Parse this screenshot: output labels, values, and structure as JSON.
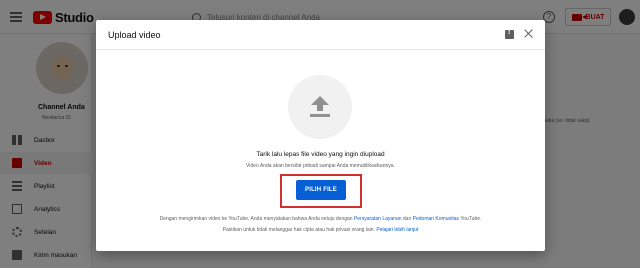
{
  "topbar": {
    "logo_text": "Studio",
    "search_placeholder": "Telusuri konten di channel Anda",
    "help_glyph": "?",
    "create_label": "BUAT"
  },
  "sidebar": {
    "channel_name": "Channel Anda",
    "channel_sub": "Novitarica 01",
    "items": [
      {
        "label": "Dasbor",
        "icon": "dashboard-icon"
      },
      {
        "label": "Video",
        "icon": "video-icon",
        "active": true
      },
      {
        "label": "Playlist",
        "icon": "playlist-icon"
      },
      {
        "label": "Analytics",
        "icon": "analytics-icon"
      },
      {
        "label": "Setelan",
        "icon": "settings-icon"
      },
      {
        "label": "Kirim masukan",
        "icon": "feedback-icon"
      }
    ]
  },
  "content": {
    "column_headers": "Komentar     Suka (vs. tidak suka)"
  },
  "dialog": {
    "title": "Upload video",
    "drag_text": "Tarik lalu lepas file video yang ingin diupload",
    "private_text": "Video Anda akan bersifat pribadi sampai Anda memublikasikannya.",
    "select_button": "PILIH FILE",
    "terms_prefix": "Dengan mengirimkan video ke YouTube, Anda menyatakan bahwa Anda setuju dengan",
    "terms_link": "Persyaratan Layanan",
    "terms_mid": "dan",
    "community_link": "Pedoman Komunitas",
    "terms_suffix": "YouTube.",
    "guide_prefix": "Pastikan untuk tidak melanggar hak cipta atau hak privasi orang lain.",
    "guide_link": "Pelajari lebih lanjut"
  },
  "colors": {
    "accent_blue": "#065fd4",
    "highlight_red": "#d32f2f",
    "brand_red": "#ff0000"
  }
}
